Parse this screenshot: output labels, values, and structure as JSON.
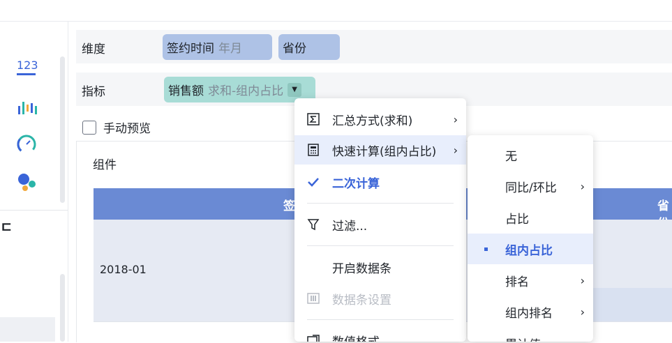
{
  "shelf": {
    "dimension_label": "维度",
    "dimension_chips": [
      {
        "label": "签约时间",
        "sub": "年月"
      },
      {
        "label": "省份",
        "sub": ""
      }
    ],
    "metric_label": "指标",
    "metric_chip": {
      "label": "销售额",
      "sub": "求和-组内占比"
    }
  },
  "preview": {
    "label": "手动预览"
  },
  "left_panel": {
    "icons": [
      "number-icon",
      "bar-chart-icon",
      "gauge-icon",
      "scatter-icon"
    ],
    "number_glyph": "123",
    "edge_glyph": "ㄷ"
  },
  "component": {
    "title": "组件",
    "headers": [
      "签",
      "省份"
    ],
    "rows": [
      {
        "cell": "2018-01"
      }
    ]
  },
  "context_menu": {
    "items": [
      {
        "icon": "sigma-icon",
        "label": "汇总方式(求和)",
        "has_submenu": true
      },
      {
        "icon": "calculator-icon",
        "label": "快速计算(组内占比)",
        "has_submenu": true,
        "highlighted": true
      },
      {
        "icon": "check-icon",
        "label": "二次计算",
        "checked": true
      },
      {
        "icon": "filter-icon",
        "label": "过滤..."
      },
      {
        "icon": "",
        "label": "开启数据条"
      },
      {
        "icon": "databar-icon",
        "label": "数据条设置",
        "disabled": true
      },
      {
        "icon": "number-format-icon",
        "label": "数值格式"
      }
    ]
  },
  "submenu": {
    "items": [
      {
        "label": "无"
      },
      {
        "label": "同比/环比",
        "has_submenu": true
      },
      {
        "label": "占比"
      },
      {
        "label": "组内占比",
        "active": true
      },
      {
        "label": "排名",
        "has_submenu": true
      },
      {
        "label": "组内排名",
        "has_submenu": true
      },
      {
        "label": "累计值"
      }
    ]
  },
  "colors": {
    "accent": "#3a64d8",
    "dimension_chip": "#aec2e6",
    "metric_chip": "#a8dcd6",
    "table_header": "#6a8ad4"
  }
}
